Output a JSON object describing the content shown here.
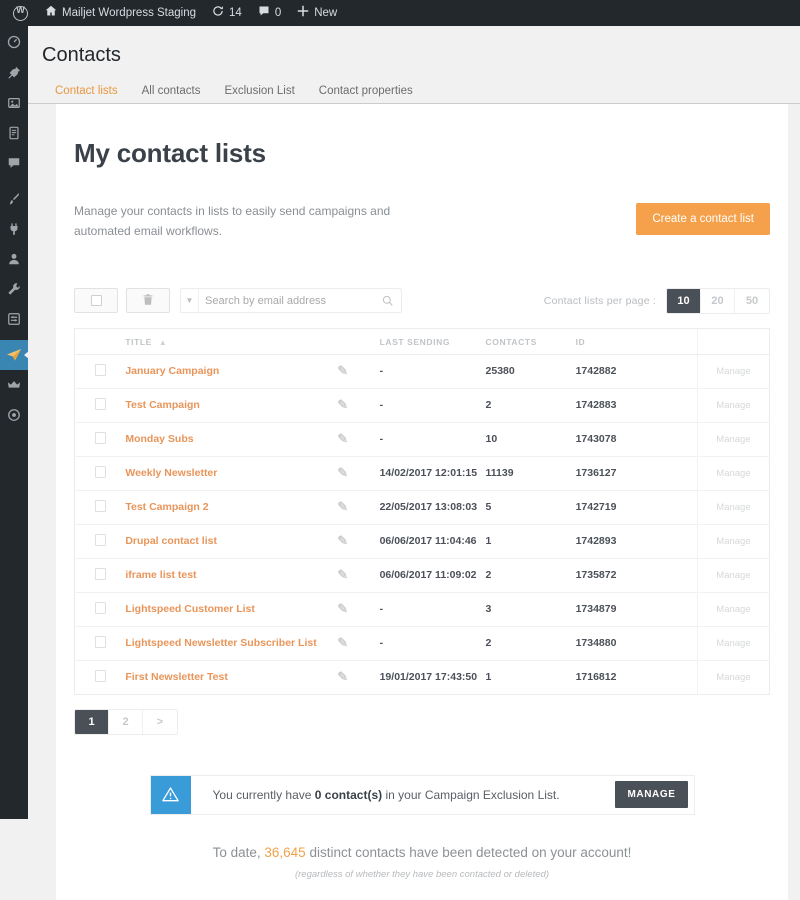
{
  "adminbar": {
    "logo_icon": "wordpress-logo-icon",
    "site_name": "Mailjet Wordpress Staging",
    "home_icon": "home-icon",
    "updates_icon": "updates-icon",
    "updates_count": "14",
    "comments_icon": "comments-icon",
    "comments_count": "0",
    "new_icon": "plus-icon",
    "new_label": "New"
  },
  "adminmenu": {
    "items": [
      {
        "name": "dashboard",
        "icon": "dashboard-icon"
      },
      {
        "name": "posts",
        "icon": "pin-icon"
      },
      {
        "name": "media",
        "icon": "media-icon"
      },
      {
        "name": "pages",
        "icon": "page-icon"
      },
      {
        "name": "comments",
        "icon": "comment-bubble-icon"
      },
      {
        "name": "appearance",
        "icon": "paintbrush-icon"
      },
      {
        "name": "plugins",
        "icon": "plug-icon"
      },
      {
        "name": "users",
        "icon": "users-icon"
      },
      {
        "name": "tools",
        "icon": "wrench-icon"
      },
      {
        "name": "settings",
        "icon": "sliders-icon"
      },
      {
        "name": "mailjet",
        "icon": "paper-plane-icon"
      },
      {
        "name": "collapse",
        "icon": "crown-icon"
      },
      {
        "name": "help",
        "icon": "circle-dot-icon"
      }
    ]
  },
  "page": {
    "heading": "Contacts",
    "tabs": [
      {
        "label": "Contact lists",
        "active": true
      },
      {
        "label": "All contacts",
        "active": false
      },
      {
        "label": "Exclusion List",
        "active": false
      },
      {
        "label": "Contact properties",
        "active": false
      }
    ]
  },
  "main": {
    "title": "My contact lists",
    "intro": "Manage your contacts in lists to easily send campaigns and automated email workflows.",
    "create_button": "Create a contact list"
  },
  "toolbar": {
    "select_all_icon": "checkbox-icon",
    "delete_icon": "trash-icon",
    "filter_caret_icon": "chevron-down-icon",
    "search_placeholder": "Search by email address",
    "search_value": "",
    "search_icon": "search-icon",
    "per_page_label": "Contact lists per page :",
    "per_page_options": [
      "10",
      "20",
      "50"
    ],
    "per_page_selected": "10"
  },
  "table": {
    "columns": [
      "TITLE",
      "LAST SENDING",
      "CONTACTS",
      "ID"
    ],
    "sort_icon": "sort-arrow-icon",
    "row_edit_icon": "pencil-icon",
    "manage_label": "Manage",
    "rows": [
      {
        "title": "January Campaign",
        "last_sending": "-",
        "contacts": "25380",
        "id": "1742882"
      },
      {
        "title": "Test Campaign",
        "last_sending": "-",
        "contacts": "2",
        "id": "1742883"
      },
      {
        "title": "Monday Subs",
        "last_sending": "-",
        "contacts": "10",
        "id": "1743078"
      },
      {
        "title": "Weekly Newsletter",
        "last_sending": "14/02/2017 12:01:15",
        "contacts": "11139",
        "id": "1736127"
      },
      {
        "title": "Test Campaign 2",
        "last_sending": "22/05/2017 13:08:03",
        "contacts": "5",
        "id": "1742719"
      },
      {
        "title": "Drupal contact list",
        "last_sending": "06/06/2017 11:04:46",
        "contacts": "1",
        "id": "1742893"
      },
      {
        "title": "iframe list test",
        "last_sending": "06/06/2017 11:09:02",
        "contacts": "2",
        "id": "1735872"
      },
      {
        "title": "Lightspeed Customer List",
        "last_sending": "-",
        "contacts": "3",
        "id": "1734879"
      },
      {
        "title": "Lightspeed Newsletter Subscriber List",
        "last_sending": "-",
        "contacts": "2",
        "id": "1734880"
      },
      {
        "title": "First Newsletter Test",
        "last_sending": "19/01/2017 17:43:50",
        "contacts": "1",
        "id": "1716812"
      }
    ]
  },
  "pagination": {
    "pages": [
      "1",
      "2",
      ">"
    ],
    "current": "1"
  },
  "notice": {
    "icon": "warning-triangle-icon",
    "text_before": "You currently have ",
    "count": "0 contact(s)",
    "text_after": " in your Campaign Exclusion List.",
    "button": "MANAGE",
    "accent_color": "#3a9bd9"
  },
  "footer": {
    "text_before": "To date, ",
    "count": "36,645",
    "text_after": " distinct contacts have been detected on your account!",
    "note": "(regardless of whether they have been contacted or deleted)",
    "accent_color": "#f0a24a"
  }
}
